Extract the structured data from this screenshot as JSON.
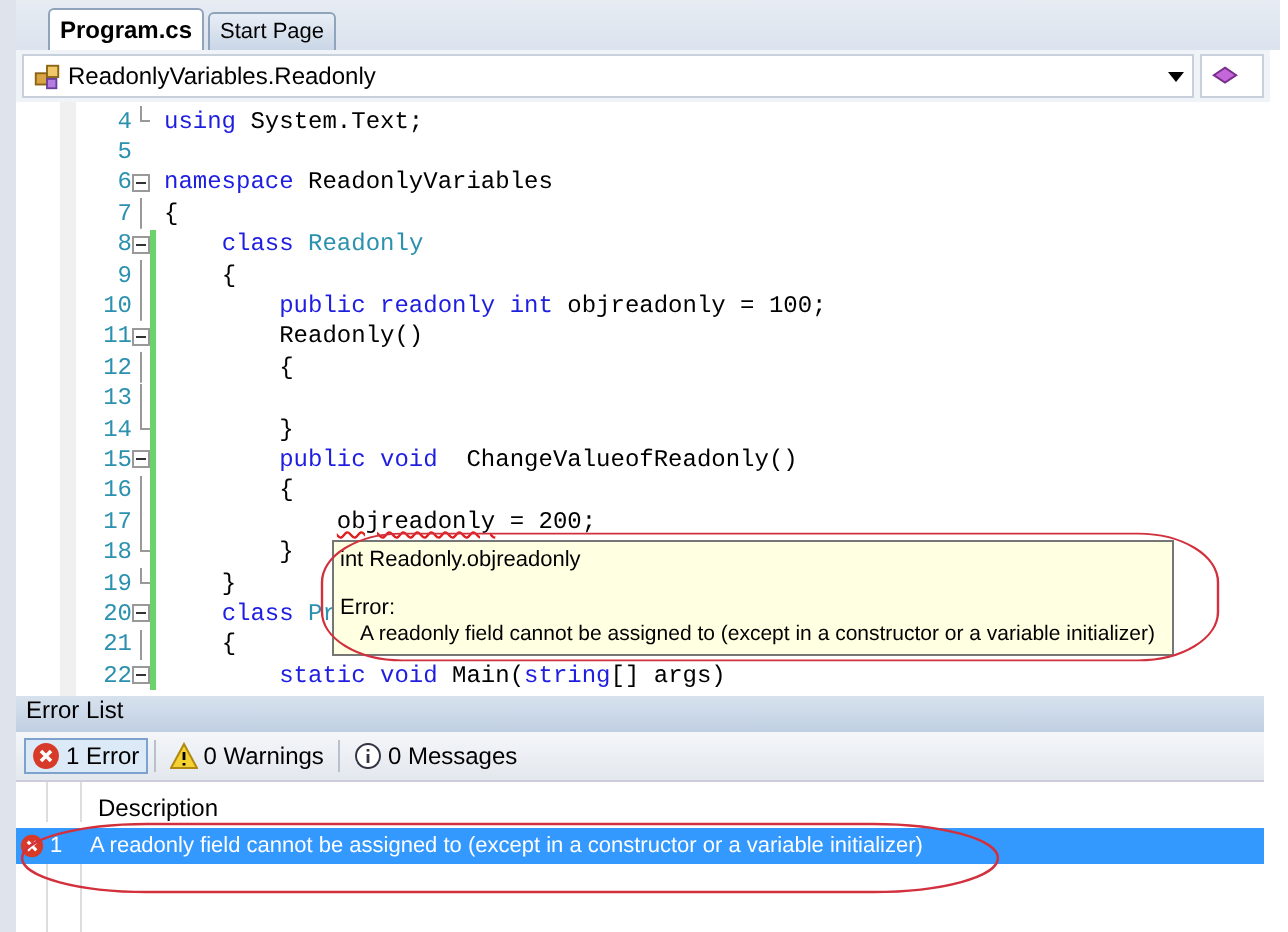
{
  "tabs": [
    {
      "label": "Program.cs",
      "selected": true
    },
    {
      "label": "Start Page",
      "selected": false
    }
  ],
  "navigation": {
    "type_dropdown": "ReadonlyVariables.Readonly"
  },
  "code_lines": [
    {
      "number": "4",
      "kind": "fold-end",
      "changed": false,
      "tokens": [
        {
          "text": "using",
          "kind": "keyword"
        },
        {
          "text": " System.Text;",
          "kind": "plain"
        }
      ]
    },
    {
      "number": "5",
      "changed": false
    },
    {
      "number": "6",
      "kind": "fold-start",
      "changed": false,
      "tokens": [
        {
          "text": "namespace",
          "kind": "keyword"
        },
        {
          "text": " ReadonlyVariables",
          "kind": "plain"
        }
      ]
    },
    {
      "number": "7",
      "kind": "fold-line",
      "changed": false,
      "tokens": [
        {
          "text": "{",
          "kind": "plain"
        }
      ]
    },
    {
      "number": "8",
      "kind": "fold-start",
      "changed": true,
      "tokens": [
        {
          "text": "    class",
          "kind": "keyword"
        },
        {
          "text": " Readonly",
          "kind": "type"
        }
      ]
    },
    {
      "number": "9",
      "kind": "fold-line",
      "changed": true,
      "tokens": [
        {
          "text": "    {",
          "kind": "plain"
        }
      ]
    },
    {
      "number": "10",
      "kind": "fold-line",
      "changed": true,
      "tokens": [
        {
          "text": "        public readonly int",
          "kind": "keyword"
        },
        {
          "text": " objreadonly = 100;",
          "kind": "plain"
        }
      ]
    },
    {
      "number": "11",
      "kind": "fold-start",
      "changed": true,
      "tokens": [
        {
          "text": "        Readonly()",
          "kind": "plain"
        }
      ]
    },
    {
      "number": "12",
      "kind": "fold-line",
      "changed": true,
      "tokens": [
        {
          "text": "        {",
          "kind": "plain"
        }
      ]
    },
    {
      "number": "13",
      "kind": "fold-line",
      "changed": true
    },
    {
      "number": "14",
      "kind": "fold-end",
      "changed": true,
      "tokens": [
        {
          "text": "        }",
          "kind": "plain"
        }
      ]
    },
    {
      "number": "15",
      "kind": "fold-start",
      "changed": true,
      "tokens": [
        {
          "text": "        public void",
          "kind": "keyword"
        },
        {
          "text": "  ChangeValueofReadonly()",
          "kind": "plain"
        }
      ]
    },
    {
      "number": "16",
      "kind": "fold-line",
      "changed": true,
      "tokens": [
        {
          "text": "        {",
          "kind": "plain"
        }
      ]
    },
    {
      "number": "17",
      "kind": "fold-line",
      "changed": true,
      "tokens": [
        {
          "text": "            objreadonly",
          "kind": "error"
        },
        {
          "text": " = 200;",
          "kind": "plain"
        }
      ]
    },
    {
      "number": "18",
      "kind": "fold-end",
      "changed": true,
      "tokens": [
        {
          "text": "        }",
          "kind": "plain"
        }
      ]
    },
    {
      "number": "19",
      "kind": "fold-end",
      "changed": true,
      "tokens": [
        {
          "text": "    }",
          "kind": "plain"
        }
      ]
    },
    {
      "number": "20",
      "kind": "fold-start",
      "changed": true,
      "tokens": [
        {
          "text": "    class",
          "kind": "keyword"
        },
        {
          "text": " Pr",
          "kind": "type"
        }
      ]
    },
    {
      "number": "21",
      "kind": "fold-line",
      "changed": true,
      "tokens": [
        {
          "text": "    {",
          "kind": "plain"
        }
      ]
    },
    {
      "number": "22",
      "kind": "fold-start",
      "changed": true,
      "tokens": [
        {
          "text": "        static void",
          "kind": "keyword"
        },
        {
          "text": " Main(",
          "kind": "plain"
        },
        {
          "text": "string",
          "kind": "keyword"
        },
        {
          "text": "[] args)",
          "kind": "plain"
        }
      ]
    }
  ],
  "tooltip": {
    "signature": "int Readonly.objreadonly",
    "label": "Error:",
    "message": "A readonly field cannot be assigned to (except in a constructor or a variable initializer)"
  },
  "error_list": {
    "title": "Error List",
    "filters": [
      {
        "kind": "error",
        "label": "1 Error",
        "selected": true
      },
      {
        "kind": "warning",
        "label": "0 Warnings",
        "selected": false
      },
      {
        "kind": "info",
        "label": "0 Messages",
        "selected": false
      }
    ],
    "columns": [
      "Description"
    ],
    "rows": [
      {
        "number": "1",
        "description": "A readonly field cannot be assigned to (except in a constructor or a variable initializer)",
        "selected": true
      }
    ]
  }
}
